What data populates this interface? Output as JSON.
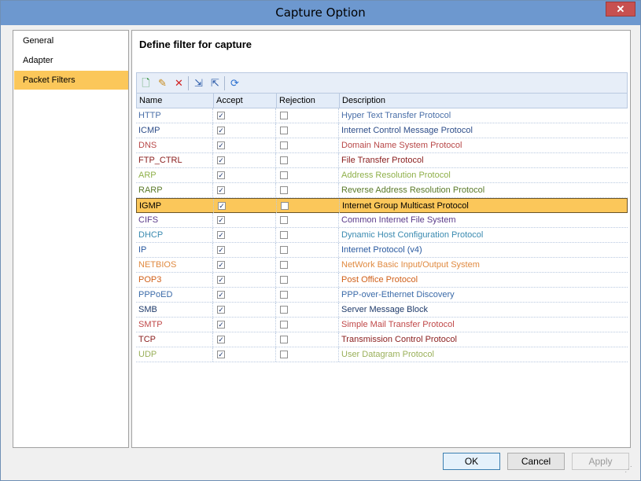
{
  "window": {
    "title": "Capture Option",
    "close_symbol": "✕"
  },
  "nav": {
    "items": [
      {
        "label": "General",
        "selected": false
      },
      {
        "label": "Adapter",
        "selected": false
      },
      {
        "label": "Packet Filters",
        "selected": true
      }
    ]
  },
  "main": {
    "heading": "Define filter for capture"
  },
  "toolbar": {
    "buttons": [
      {
        "name": "new-filter-icon",
        "glyph": "🗋",
        "color": "#2f8f3a"
      },
      {
        "name": "edit-filter-icon",
        "glyph": "✎",
        "color": "#c78a1b"
      },
      {
        "name": "delete-filter-icon",
        "glyph": "✕",
        "color": "#d02020"
      },
      {
        "name": "import-filter-icon",
        "glyph": "⇲",
        "color": "#2a5aa8"
      },
      {
        "name": "export-filter-icon",
        "glyph": "⇱",
        "color": "#2a5aa8"
      },
      {
        "name": "refresh-icon",
        "glyph": "⟳",
        "color": "#2a6fd0"
      }
    ]
  },
  "table": {
    "headers": {
      "name": "Name",
      "accept": "Accept",
      "rejection": "Rejection",
      "description": "Description"
    },
    "rows": [
      {
        "name": "HTTP",
        "description": "Hyper Text Transfer Protocol",
        "accept": true,
        "rejection": false,
        "color": "#4a6fa8"
      },
      {
        "name": "ICMP",
        "description": "Internet Control Message Protocol",
        "accept": true,
        "rejection": false,
        "color": "#2e4e8a"
      },
      {
        "name": "DNS",
        "description": "Domain Name System Protocol",
        "accept": true,
        "rejection": false,
        "color": "#b84848"
      },
      {
        "name": "FTP_CTRL",
        "description": "File Transfer Protocol",
        "accept": true,
        "rejection": false,
        "color": "#8a1e1e"
      },
      {
        "name": "ARP",
        "description": "Address Resolution Protocol",
        "accept": true,
        "rejection": false,
        "color": "#8fb04a"
      },
      {
        "name": "RARP",
        "description": "Reverse Address Resolution Protocol",
        "accept": true,
        "rejection": false,
        "color": "#5a7a2a"
      },
      {
        "name": "IGMP",
        "description": "Internet Group Multicast Protocol",
        "accept": true,
        "rejection": false,
        "color": "#000000",
        "selected": true
      },
      {
        "name": "CIFS",
        "description": "Common Internet File System",
        "accept": true,
        "rejection": false,
        "color": "#5a3a8a"
      },
      {
        "name": "DHCP",
        "description": "Dynamic Host Configuration Protocol",
        "accept": true,
        "rejection": false,
        "color": "#3a8ab0"
      },
      {
        "name": "IP",
        "description": "Internet Protocol (v4)",
        "accept": true,
        "rejection": false,
        "color": "#2a5aa0"
      },
      {
        "name": "NETBIOS",
        "description": "NetWork Basic Input/Output System",
        "accept": true,
        "rejection": false,
        "color": "#e08a40"
      },
      {
        "name": "POP3",
        "description": "Post Office Protocol",
        "accept": true,
        "rejection": false,
        "color": "#d0601a"
      },
      {
        "name": "PPPoED",
        "description": "PPP-over-Ethernet Discovery",
        "accept": true,
        "rejection": false,
        "color": "#3a6aa8"
      },
      {
        "name": "SMB",
        "description": "Server Message Block",
        "accept": true,
        "rejection": false,
        "color": "#1e3a6a"
      },
      {
        "name": "SMTP",
        "description": "Simple Mail Transfer Protocol",
        "accept": true,
        "rejection": false,
        "color": "#c04848"
      },
      {
        "name": "TCP",
        "description": "Transmission Control Protocol",
        "accept": true,
        "rejection": false,
        "color": "#8a1e1e"
      },
      {
        "name": "UDP",
        "description": "User Datagram Protocol",
        "accept": true,
        "rejection": false,
        "color": "#9ab05a"
      }
    ]
  },
  "footer": {
    "ok_label": "OK",
    "cancel_label": "Cancel",
    "apply_label": "Apply"
  }
}
